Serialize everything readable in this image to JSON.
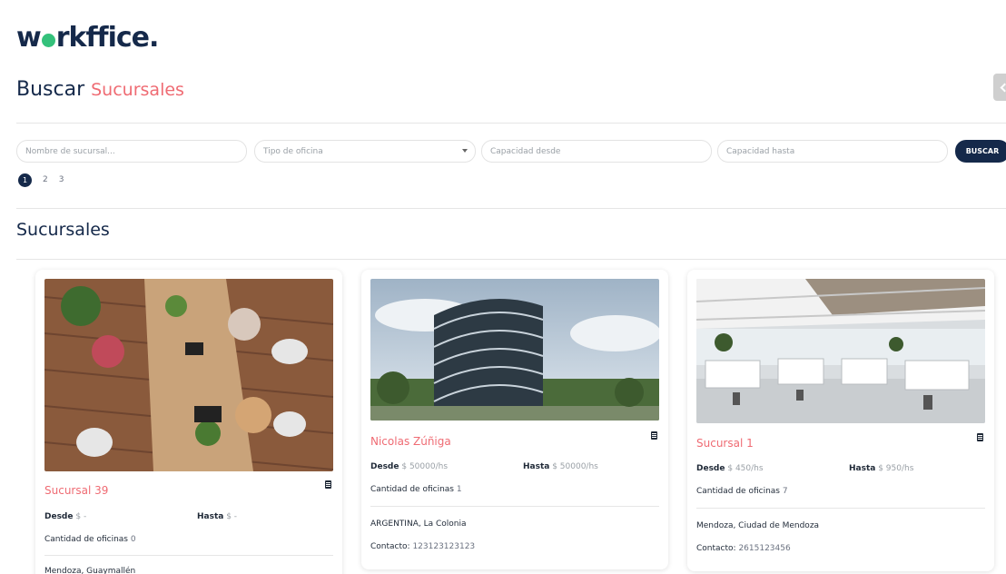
{
  "brand": {
    "logo_pre": "w",
    "logo_post": "rkffice."
  },
  "header": {
    "title_main": "Buscar",
    "title_accent": "Sucursales"
  },
  "filters": {
    "name_placeholder": "Nombre de sucursal...",
    "type_placeholder": "Tipo de oficina",
    "cap_from_placeholder": "Capacidad desde",
    "cap_to_placeholder": "Capacidad hasta",
    "search_label": "BUSCAR"
  },
  "pagination": {
    "pages": [
      "1",
      "2",
      "3"
    ],
    "current": "1"
  },
  "section": {
    "title": "Sucursales"
  },
  "cards": [
    {
      "name": "Sucursal 39",
      "desde_label": "Desde",
      "desde_value": "$ -",
      "hasta_label": "Hasta",
      "hasta_value": "$ -",
      "oficinas_label": "Cantidad de oficinas",
      "oficinas_value": "0",
      "location": "Mendoza, Guaymallén",
      "contacto_label": "",
      "contacto_value": ""
    },
    {
      "name": "Nicolas Zúñiga",
      "desde_label": "Desde",
      "desde_value": "$ 50000/hs",
      "hasta_label": "Hasta",
      "hasta_value": "$ 50000/hs",
      "oficinas_label": "Cantidad de oficinas",
      "oficinas_value": "1",
      "location": "ARGENTINA, La Colonia",
      "contacto_label": "Contacto:",
      "contacto_value": "123123123123"
    },
    {
      "name": "Sucursal 1",
      "desde_label": "Desde",
      "desde_value": "$ 450/hs",
      "hasta_label": "Hasta",
      "hasta_value": "$ 950/hs",
      "oficinas_label": "Cantidad de oficinas",
      "oficinas_value": "7",
      "location": "Mendoza, Ciudad de Mendoza",
      "contacto_label": "Contacto:",
      "contacto_value": "2615123456"
    }
  ],
  "colors": {
    "navy": "#15294a",
    "accent": "#ef6b73",
    "logo_dot": "#34c17b"
  },
  "icons": {
    "building": "building-icon",
    "caret": "chevron-down-icon"
  }
}
